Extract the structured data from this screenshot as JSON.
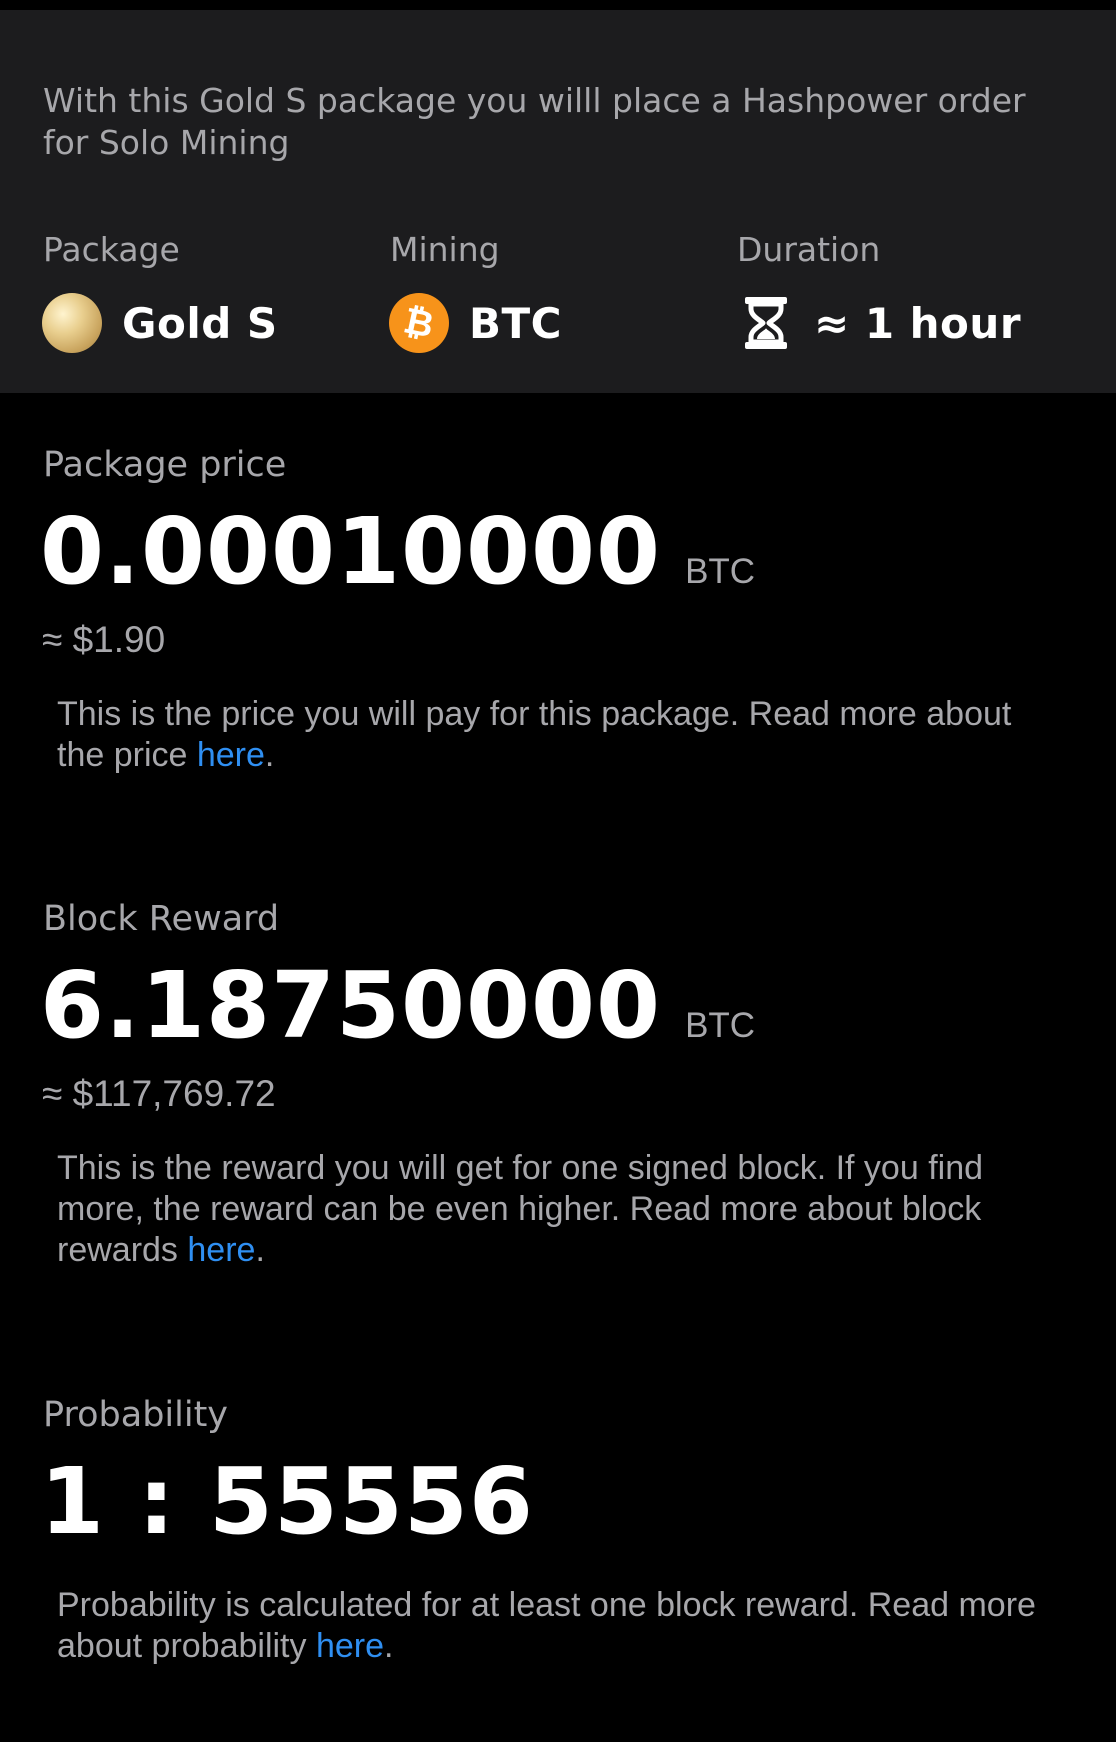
{
  "intro": "With this Gold S package you willl place a Hashpower order for Solo Mining",
  "meta": {
    "package": {
      "label": "Package",
      "value": "Gold S"
    },
    "mining": {
      "label": "Mining",
      "value": "BTC",
      "coin_glyph": "₿"
    },
    "duration": {
      "label": "Duration",
      "value": "≈ 1 hour"
    }
  },
  "price": {
    "label": "Package price",
    "amount": "0.00010000",
    "unit": "BTC",
    "fiat": "≈ $1.90",
    "desc": "This is the price you will pay for this package. Read more about the price ",
    "link": "here",
    "end": "."
  },
  "reward": {
    "label": "Block Reward",
    "amount": "6.18750000",
    "unit": "BTC",
    "fiat": "≈ $117,769.72",
    "desc": "This is the reward you will get for one signed block. If you find more, the reward can be even higher. Read more about block rewards ",
    "link": "here",
    "end": "."
  },
  "probability": {
    "label": "Probability",
    "amount": "1 : 55556",
    "desc": "Probability is calculated for at least one block reward. Read more about probability ",
    "link": "here",
    "end": "."
  },
  "colors": {
    "background": "#000000",
    "header_bg": "#1c1c1e",
    "muted_text": "#a7a7ab",
    "link": "#2f8ff2",
    "bitcoin": "#f7931a"
  }
}
